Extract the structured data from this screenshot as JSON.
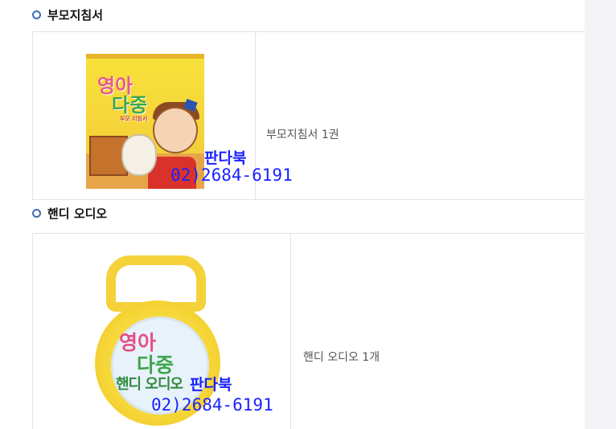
{
  "sections": [
    {
      "title": "부모지침서",
      "image_name": "parent-guide-book",
      "description": "부모지침서 1권",
      "art_title_line1": "영아",
      "art_title_line2": "다중",
      "art_subtitle": "부모 지침서"
    },
    {
      "title": "핸디 오디오",
      "image_name": "handy-audio",
      "description": "핸디 오디오 1개",
      "art_title_line1": "영아",
      "art_title_line2": "다중",
      "art_subtitle": "핸디 오디오"
    }
  ],
  "watermark": {
    "name": "판다북",
    "phone": "02)2684-6191"
  },
  "colors": {
    "bullet": "#3d6db5",
    "watermark": "#1a22ff",
    "border": "#e3e3e3"
  }
}
